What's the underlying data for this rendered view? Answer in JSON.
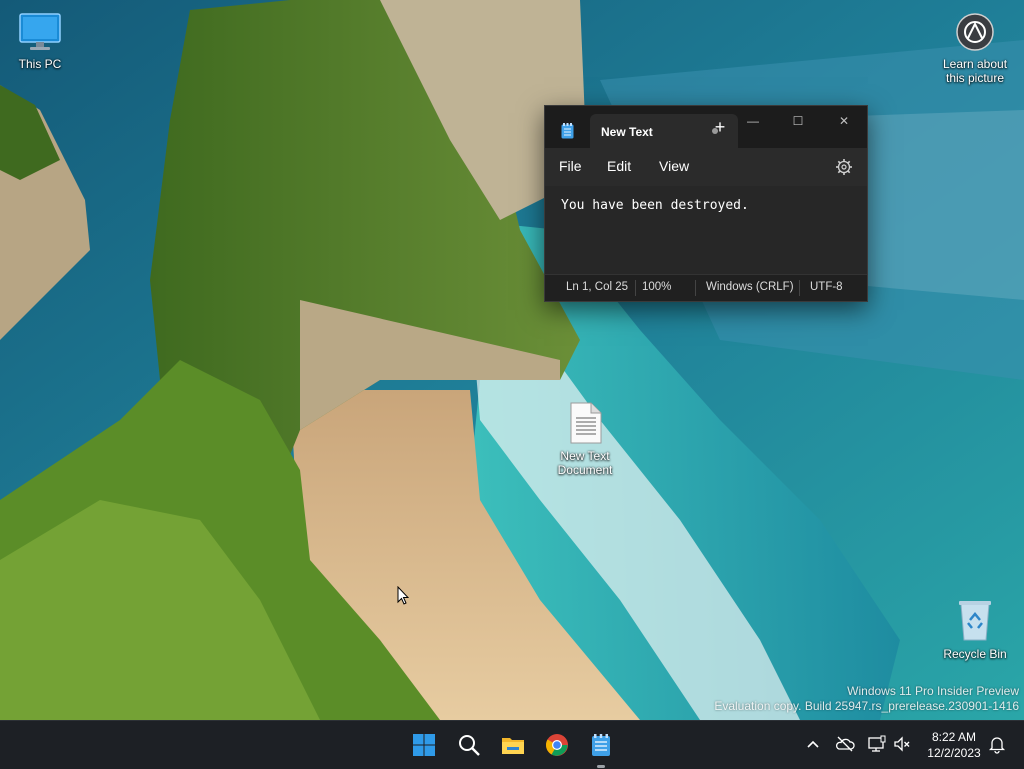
{
  "desktop": {
    "icons": [
      {
        "label": "This PC"
      },
      {
        "label": "Learn about this picture"
      },
      {
        "label": "New Text Document"
      },
      {
        "label": "Recycle Bin"
      }
    ]
  },
  "notepad": {
    "tab_title": "New Text",
    "new_tab_symbol": "+",
    "controls": {
      "minimize": "—",
      "maximize": "☐",
      "close": "✕"
    },
    "menu": [
      "File",
      "Edit",
      "View"
    ],
    "content": "You have been destroyed.",
    "status": {
      "position": "Ln 1, Col 25",
      "zoom": "100%",
      "line_ending": "Windows (CRLF)",
      "encoding": "UTF-8"
    }
  },
  "taskbar": {
    "apps": [
      "start",
      "search",
      "file-explorer",
      "chrome",
      "notepad"
    ],
    "clock": {
      "time": "8:22 AM",
      "date": "12/2/2023"
    }
  },
  "watermark": {
    "line1": "Windows 11 Pro Insider Preview",
    "line2": "Evaluation copy. Build 25947.rs_prerelease.230901-1416"
  },
  "colors": {
    "accent": "#0a84d6",
    "taskbar": "#1d2025",
    "notepad_bg": "#202020"
  }
}
